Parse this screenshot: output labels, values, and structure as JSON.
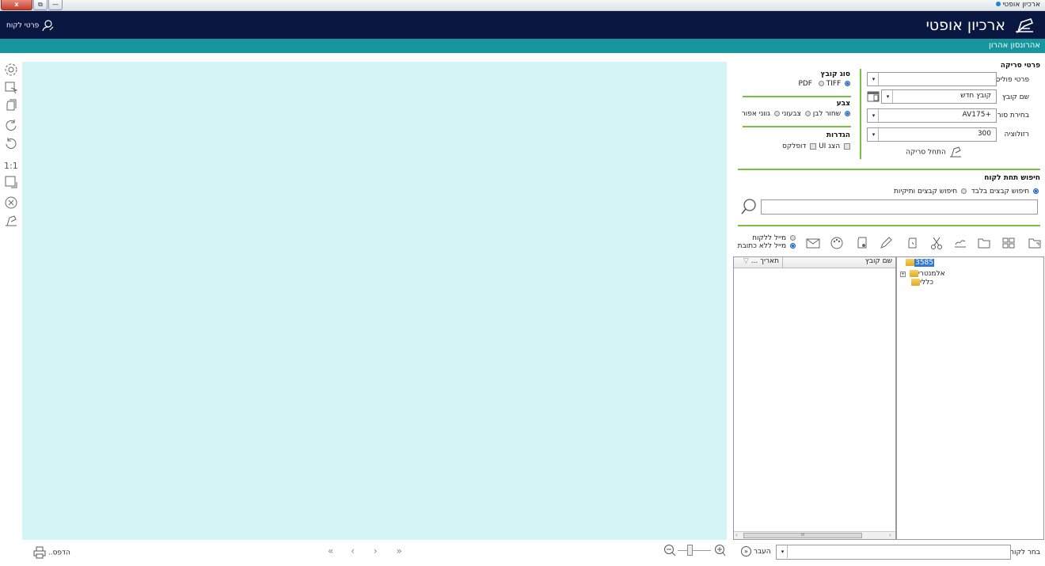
{
  "window": {
    "title": "ארכיון אופטי",
    "close_label": "x"
  },
  "header": {
    "app_title": "ארכיון אופטי",
    "customer_details_link": "פרטי לקוח",
    "user_name": "אהרונסון  אהרון"
  },
  "scan_panel": {
    "heading": "פרטי סריקה",
    "policy_label": "פרטי פוליסה",
    "policy_value": "",
    "filename_label": "שם קובץ",
    "filename_value": "קובץ חדש",
    "scanner_label": "בחירת סורק",
    "scanner_value": "AV175+",
    "resolution_label": "רזולוציה",
    "resolution_value": "300",
    "start_scan_label": "התחל סריקה",
    "file_type_heading": "סוג קובץ",
    "file_types": [
      {
        "label": "PDF",
        "selected": true
      },
      {
        "label": "TIFF",
        "selected": false
      }
    ],
    "color_heading": "צבע",
    "colors": [
      {
        "label": "שחור לבן",
        "selected": true
      },
      {
        "label": "צבעוני",
        "selected": false
      },
      {
        "label": "גווני אפור",
        "selected": false
      }
    ],
    "settings_heading": "הגדרות",
    "settings": [
      {
        "label": "הצג UI",
        "checked": false
      },
      {
        "label": "דופלקס",
        "checked": false
      }
    ]
  },
  "search_panel": {
    "heading": "חיפוש תחת לקוח",
    "options": [
      {
        "label": "חיפוש קבצים בלבד",
        "selected": true
      },
      {
        "label": "חיפוש קבצים ותיקיות",
        "selected": false
      }
    ],
    "query": ""
  },
  "mail_options": [
    {
      "label": "מייל ללקוח",
      "selected": false
    },
    {
      "label": "מייל ללא כתובת",
      "selected": true
    }
  ],
  "tree": {
    "root": "3585",
    "children": [
      "אלמנטרי",
      "כללי"
    ]
  },
  "file_list": {
    "columns": [
      "שם קובץ",
      "תאריך ..."
    ],
    "rows": [],
    "scrollbar_glyph": "III"
  },
  "bottom_bar": {
    "choose_customer_label": "בחר לקוח",
    "transfer_label": "העבר",
    "print_label": "הדפס..",
    "nav": [
      "«",
      "‹",
      "›",
      "»"
    ],
    "zoom_ratio_label": "1:1"
  },
  "icons": {
    "left_toolbar": [
      "settings-icon",
      "select-icon",
      "copy-page-icon",
      "rotate-right-icon",
      "rotate-left-icon",
      "actual-size-icon",
      "fit-page-icon",
      "close-circle-icon",
      "scanner-icon"
    ],
    "file_toolbar": [
      "new-folder-icon",
      "thumbnails-icon",
      "folder-icon",
      "sign-icon",
      "cut-icon",
      "duplicate-icon",
      "edit-icon",
      "add-page-icon",
      "palette-icon",
      "mail-icon"
    ]
  },
  "colors": {
    "header_bg": "#0a1740",
    "subheader_bg": "#1697a0",
    "viewer_bg": "#d4f4f6",
    "divider_green": "#7bc043"
  }
}
